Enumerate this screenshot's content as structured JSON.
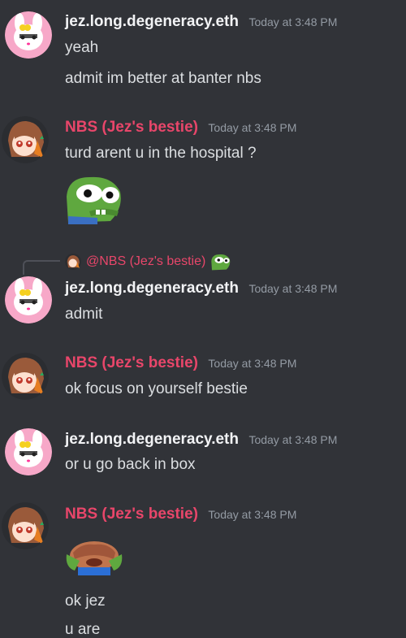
{
  "colors": {
    "background": "#313338",
    "jez_name": "#f2f3f5",
    "nbs_name": "#e8466a",
    "text": "#dbdee1",
    "timestamp": "#949ba4"
  },
  "users": {
    "jez": {
      "name": "jez.long.degeneracy.eth",
      "avatar_icon": "my-melody-avatar-icon"
    },
    "nbs": {
      "name": "NBS (Jez's bestie)",
      "avatar_icon": "anime-girl-avatar-icon"
    }
  },
  "messages": [
    {
      "author": "jez.long.degeneracy.eth",
      "time": "Today at 3:48 PM",
      "lines": [
        "yeah",
        "admit im better at banter nbs"
      ]
    },
    {
      "author": "NBS (Jez's bestie)",
      "time": "Today at 3:48 PM",
      "lines": [
        "turd arent u in the hospital ?"
      ],
      "emoji": "pepe-wide-eyes-emoji"
    },
    {
      "author": "jez.long.degeneracy.eth",
      "time": "Today at 3:48 PM",
      "reply": {
        "mention": "@NBS (Jez's bestie)",
        "emoji": "pepe-small-emoji"
      },
      "lines": [
        "admit"
      ]
    },
    {
      "author": "NBS (Jez's bestie)",
      "time": "Today at 3:48 PM",
      "lines": [
        "ok focus on yourself bestie"
      ]
    },
    {
      "author": "jez.long.degeneracy.eth",
      "time": "Today at 3:48 PM",
      "lines": [
        "or u go back in box"
      ]
    },
    {
      "author": "NBS (Jez's bestie)",
      "time": "Today at 3:48 PM",
      "emoji": "peepo-cry-emoji",
      "lines": [
        "ok jez",
        "u are"
      ]
    }
  ]
}
